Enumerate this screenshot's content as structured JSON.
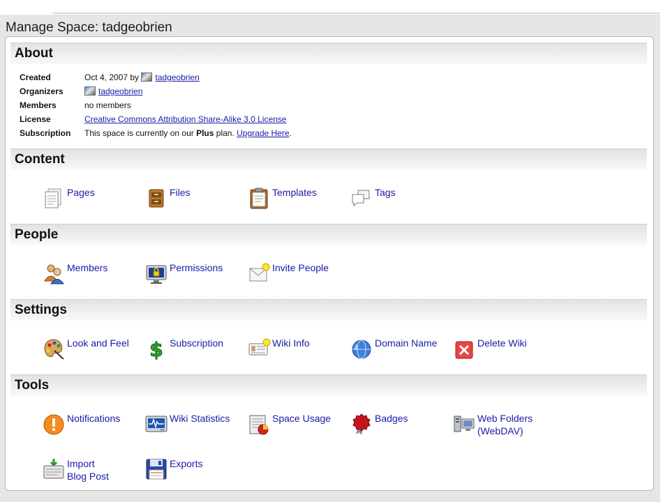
{
  "page": {
    "title": "Manage Space: tadgeobrien"
  },
  "about": {
    "heading": "About",
    "created_label": "Created",
    "created_prefix": "Oct 4, 2007 by",
    "created_user": "tadgeobrien",
    "organizers_label": "Organizers",
    "organizer_user": "tadgeobrien",
    "members_label": "Members",
    "members_value": "no members",
    "license_label": "License",
    "license_link": "Creative Commons Attribution Share-Alike 3.0 License",
    "subscription_label": "Subscription",
    "subscription_prefix": "This space is currently on our",
    "subscription_plan": "Plus",
    "subscription_mid": "plan.",
    "subscription_link": "Upgrade Here",
    "subscription_end": "."
  },
  "content": {
    "heading": "Content",
    "items": [
      {
        "label": "Pages",
        "icon": "pages-icon"
      },
      {
        "label": "Files",
        "icon": "files-icon"
      },
      {
        "label": "Templates",
        "icon": "templates-icon"
      },
      {
        "label": "Tags",
        "icon": "tags-icon"
      }
    ]
  },
  "people": {
    "heading": "People",
    "items": [
      {
        "label": "Members",
        "icon": "members-icon"
      },
      {
        "label": "Permissions",
        "icon": "permissions-icon"
      },
      {
        "label": "Invite People",
        "icon": "invite-icon"
      }
    ]
  },
  "settings": {
    "heading": "Settings",
    "items": [
      {
        "label": "Look and Feel",
        "icon": "palette-icon"
      },
      {
        "label": "Subscription",
        "icon": "dollar-icon"
      },
      {
        "label": "Wiki Info",
        "icon": "wiki-info-icon"
      },
      {
        "label": "Domain Name",
        "icon": "globe-icon"
      },
      {
        "label": "Delete Wiki",
        "icon": "delete-icon"
      }
    ]
  },
  "tools": {
    "heading": "Tools",
    "items": [
      {
        "label": "Notifications",
        "icon": "notification-icon"
      },
      {
        "label": "Wiki Statistics",
        "icon": "statistics-icon"
      },
      {
        "label": "Space Usage",
        "icon": "space-usage-icon"
      },
      {
        "label": "Badges",
        "icon": "badge-icon"
      },
      {
        "label": "Web Folders\n(WebDAV)",
        "icon": "web-folders-icon"
      },
      {
        "label": "Import\nBlog Post",
        "icon": "import-icon"
      },
      {
        "label": "Exports",
        "icon": "exports-icon"
      }
    ]
  },
  "colors": {
    "link": "#1a1aa8",
    "panel_bg": "#ffffff",
    "outer_bg": "#e6e6e6"
  }
}
